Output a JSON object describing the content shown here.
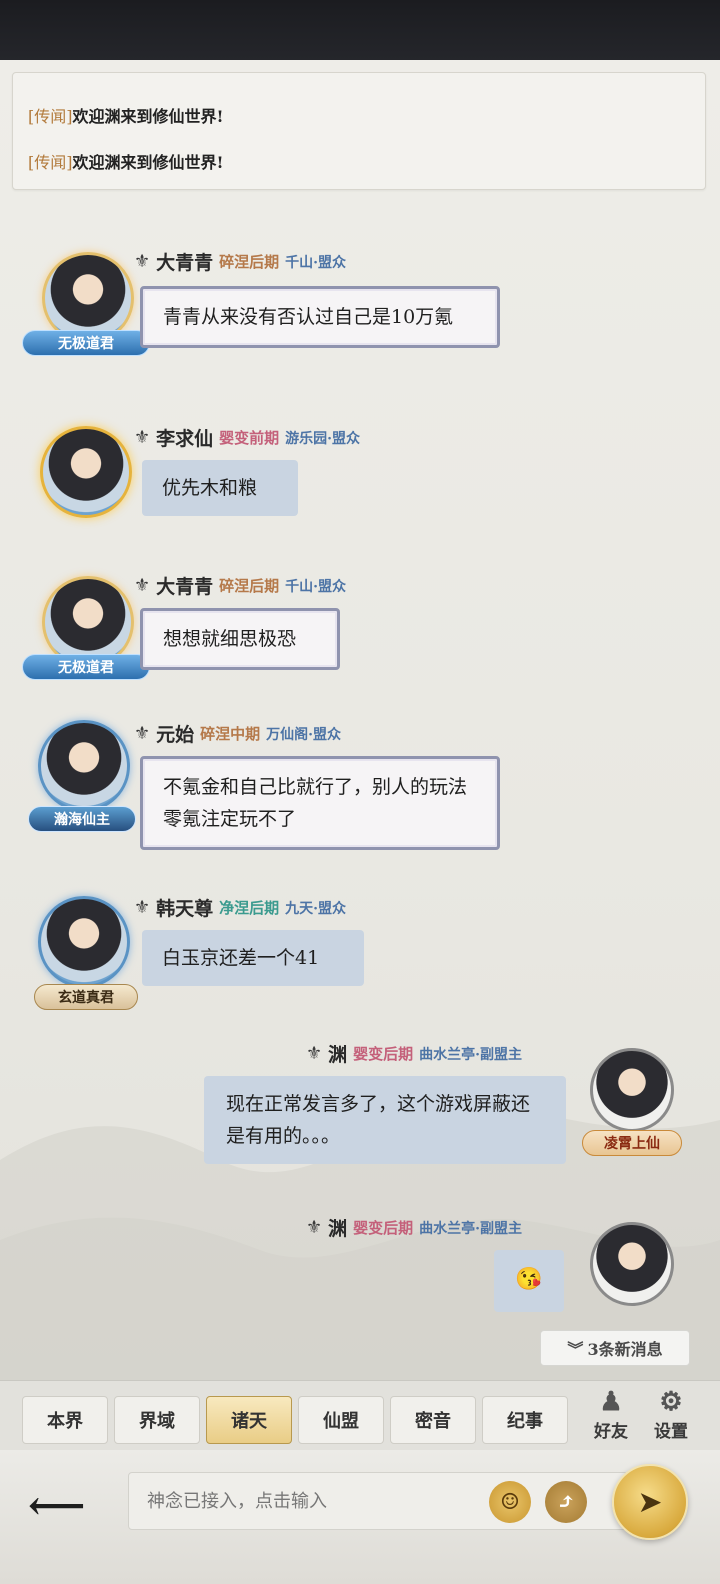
{
  "notices": [
    {
      "tag": "[传闻]",
      "text": "欢迎渊来到修仙世界!"
    },
    {
      "tag": "[传闻]",
      "text": "欢迎渊来到修仙世界!"
    }
  ],
  "messages": [
    {
      "name": "大青青",
      "realm": "碎涅后期",
      "guild": "千山·盟众",
      "badge": "无极道君",
      "text": "青青从来没有否认过自己是10万氪",
      "side": "left"
    },
    {
      "name": "李求仙",
      "realm": "婴变前期",
      "guild": "游乐园·盟众",
      "badge": "",
      "text": "优先木和粮",
      "side": "left"
    },
    {
      "name": "大青青",
      "realm": "碎涅后期",
      "guild": "千山·盟众",
      "badge": "无极道君",
      "text": "想想就细思极恐",
      "side": "left"
    },
    {
      "name": "元始",
      "realm": "碎涅中期",
      "guild": "万仙阁·盟众",
      "badge": "瀚海仙主",
      "text": "不氪金和自己比就行了，别人的玩法零氪注定玩不了",
      "side": "left"
    },
    {
      "name": "韩天尊",
      "realm": "净涅后期",
      "guild": "九天·盟众",
      "badge": "玄道真君",
      "text": "白玉京还差一个41",
      "side": "left"
    },
    {
      "name": "渊",
      "realm": "婴变后期",
      "guild": "曲水兰亭·副盟主",
      "badge": "凌霄上仙",
      "text": "现在正常发言多了，这个游戏屏蔽还是有用的。。。",
      "side": "right"
    },
    {
      "name": "渊",
      "realm": "婴变后期",
      "guild": "曲水兰亭·副盟主",
      "badge": "",
      "text": "😘",
      "side": "right"
    }
  ],
  "new_messages": "3条新消息",
  "tabs": [
    "本界",
    "界域",
    "诸天",
    "仙盟",
    "密音",
    "纪事"
  ],
  "active_tab": "诸天",
  "side_buttons": [
    {
      "label": "好友",
      "icon": "friend-icon"
    },
    {
      "label": "设置",
      "icon": "gear-icon"
    }
  ],
  "input": {
    "placeholder": "神念已接入，点击输入"
  }
}
